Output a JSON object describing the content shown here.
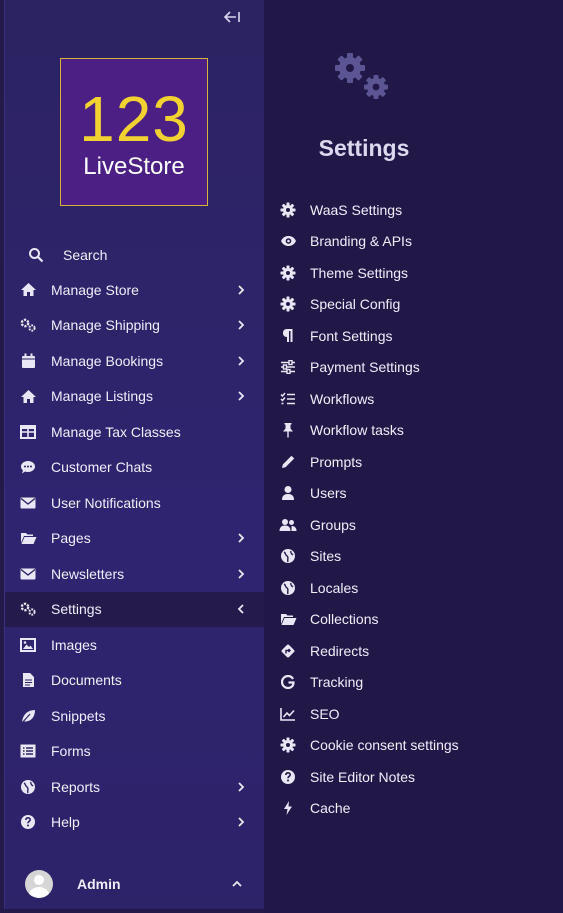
{
  "logo": {
    "number": "123",
    "name": "LiveStore"
  },
  "sidebar": {
    "items": [
      {
        "label": "Search"
      },
      {
        "label": "Manage Store"
      },
      {
        "label": "Manage Shipping"
      },
      {
        "label": "Manage Bookings"
      },
      {
        "label": "Manage Listings"
      },
      {
        "label": "Manage Tax Classes"
      },
      {
        "label": "Customer Chats"
      },
      {
        "label": "User Notifications"
      },
      {
        "label": "Pages"
      },
      {
        "label": "Newsletters"
      },
      {
        "label": "Settings"
      },
      {
        "label": "Images"
      },
      {
        "label": "Documents"
      },
      {
        "label": "Snippets"
      },
      {
        "label": "Forms"
      },
      {
        "label": "Reports"
      },
      {
        "label": "Help"
      }
    ],
    "user": {
      "name": "Admin"
    }
  },
  "panel": {
    "title": "Settings",
    "items": [
      {
        "label": "WaaS Settings"
      },
      {
        "label": "Branding & APIs"
      },
      {
        "label": "Theme Settings"
      },
      {
        "label": "Special Config"
      },
      {
        "label": "Font Settings"
      },
      {
        "label": "Payment Settings"
      },
      {
        "label": "Workflows"
      },
      {
        "label": "Workflow tasks"
      },
      {
        "label": "Prompts"
      },
      {
        "label": "Users"
      },
      {
        "label": "Groups"
      },
      {
        "label": "Sites"
      },
      {
        "label": "Locales"
      },
      {
        "label": "Collections"
      },
      {
        "label": "Redirects"
      },
      {
        "label": "Tracking"
      },
      {
        "label": "SEO"
      },
      {
        "label": "Cookie consent settings"
      },
      {
        "label": "Site Editor Notes"
      },
      {
        "label": "Cache"
      }
    ]
  },
  "colors": {
    "sidebar_bg": "#2c2362",
    "panel_bg": "#221848",
    "logo_bg": "#4b1f83",
    "logo_number": "#f1d231",
    "active_bg": "#241b4c"
  }
}
